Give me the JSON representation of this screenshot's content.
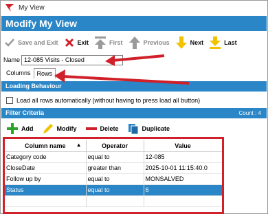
{
  "window": {
    "title": "My View"
  },
  "banner": {
    "title": "Modify My View"
  },
  "toolbar": {
    "save_exit": "Save and Exit",
    "exit": "Exit",
    "first": "First",
    "previous": "Previous",
    "next": "Next",
    "last": "Last"
  },
  "name_field": {
    "label": "Name",
    "value": "12-085 Visits - Closed"
  },
  "tabs": [
    {
      "label": "Columns"
    },
    {
      "label": "Rows"
    }
  ],
  "loading": {
    "header": "Loading Behaviour",
    "checkbox_label": "Load all rows automatically (without having to press load all button)"
  },
  "filter": {
    "header": "Filter Criteria",
    "count": "Count : 4",
    "add": "Add",
    "modify": "Modify",
    "delete": "Delete",
    "duplicate": "Duplicate",
    "columns": [
      "Column name",
      "Operator",
      "Value"
    ],
    "rows": [
      [
        "Category code",
        "equal to",
        "12-085"
      ],
      [
        "CloseDate",
        "greater than",
        "2025-10-01 11:15:40.0"
      ],
      [
        "Follow up by",
        "equal to",
        "MONSALVED"
      ],
      [
        "Status",
        "equal to",
        "6"
      ]
    ]
  },
  "colors": {
    "accent": "#2a86c6",
    "annotation": "#d0202a"
  }
}
